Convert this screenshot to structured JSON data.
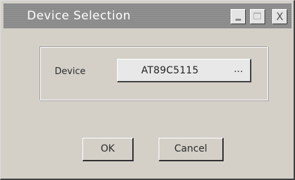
{
  "window": {
    "title": "Device Selection",
    "controls": {
      "minimize_icon": "minimize-icon",
      "maximize_icon": "maximize-icon",
      "close_label": "X"
    }
  },
  "form": {
    "device_label": "Device",
    "device_value": "AT89C5115",
    "browse_label": "..."
  },
  "buttons": {
    "ok_label": "OK",
    "cancel_label": "Cancel"
  }
}
